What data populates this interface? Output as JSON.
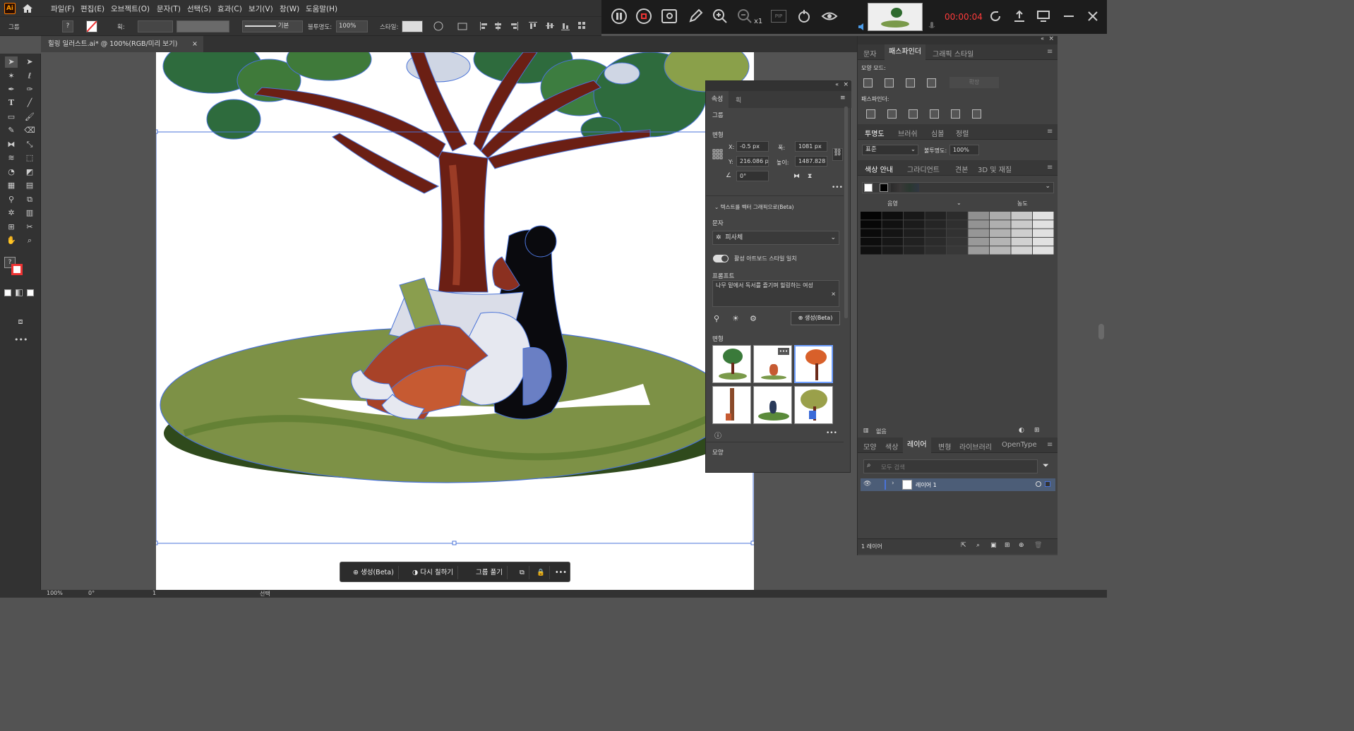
{
  "app": {
    "logo": "Ai"
  },
  "menu": [
    "파일(F)",
    "편집(E)",
    "오브젝트(O)",
    "문자(T)",
    "선택(S)",
    "효과(C)",
    "보기(V)",
    "창(W)",
    "도움말(H)"
  ],
  "recorder": {
    "zoom_label": "x1",
    "pip_label": "PIP",
    "timer": "00:00:04",
    "timer_color": "#ff3b3b"
  },
  "control_bar": {
    "selection_label": "그룹",
    "stroke_label": "획:",
    "stroke_style": "기본",
    "opacity_label": "불투명도:",
    "opacity_value": "100%",
    "style_label": "스타일:"
  },
  "document_tab": {
    "title": "힐링 일러스트.ai* @ 100%(RGB/미리 보기)",
    "close": "×"
  },
  "properties_panel": {
    "tabs": [
      "속성",
      "획"
    ],
    "group_label": "그룹",
    "transform_title": "변형",
    "x_label": "X:",
    "x_value": "-0.5 px",
    "y_label": "Y:",
    "y_value": "216.086 p",
    "w_label": "폭:",
    "w_value": "1081 px",
    "h_label": "높이:",
    "h_value": "1487.828",
    "angle_value": "0°",
    "text_to_vector_title": "텍스트를 벡터 그래픽으로(Beta)",
    "type_label": "문자",
    "type_value": "피사체",
    "match_style_label": "활성 아트보드 스타일 일치",
    "prompt_label": "프롬프트",
    "prompt_value": "나무 밑에서 독서를 즐기며 힐링하는 여성",
    "generate_label": "생성(Beta)",
    "variations_label": "변형",
    "appearance_label": "모양"
  },
  "right_panel": {
    "top_tabs": [
      "문자",
      "패스파인더",
      "그래픽 스타일"
    ],
    "shape_modes_label": "모양 모드:",
    "expand_label": "확장",
    "pathfinders_label": "패스파인더:",
    "transparency_tabs": [
      "투명도",
      "브러쉬",
      "심볼",
      "정렬"
    ],
    "blend_mode": "표준",
    "opacity_label": "불투명도:",
    "opacity_value": "100%",
    "color_guide_tabs": [
      "색상 안내",
      "그라디언트",
      "견본",
      "3D 및 재질"
    ],
    "shade_label": "음영",
    "tint_label": "농도",
    "none_label": "없음",
    "layers_tabs": [
      "모양",
      "색상",
      "레이어",
      "변형",
      "라이브러리",
      "OpenType"
    ],
    "search_placeholder": "모두 검색",
    "layer_name": "레이어 1",
    "layer_count": "1 레이어"
  },
  "floating_bar": {
    "generate": "생성(Beta)",
    "recolor": "다시 칠하기",
    "ungroup": "그룹 풀기"
  },
  "status_bar": {
    "zoom": "100%",
    "rotation": "0°",
    "artboard": "1",
    "mode": "선택"
  }
}
